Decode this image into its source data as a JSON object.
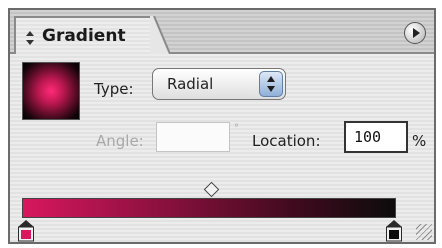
{
  "panel": {
    "tab_title": "Gradient",
    "type_label": "Type:",
    "type_value": "Radial",
    "angle_label": "Angle:",
    "angle_value": "",
    "degree_symbol": "°",
    "location_label": "Location:",
    "location_value": "100",
    "percent_symbol": "%"
  },
  "gradient": {
    "start_color": "#d8175f",
    "end_color": "#0c0c0c",
    "midpoint_percent": 50,
    "start_location_percent": 0,
    "end_location_percent": 100
  },
  "icons": {
    "tab_arrows": "updown-arrows-icon",
    "panel_menu": "panel-menu-icon",
    "stepper": "stepper-arrows-icon",
    "midpoint": "midpoint-diamond-icon",
    "resize": "resize-grip-icon"
  }
}
